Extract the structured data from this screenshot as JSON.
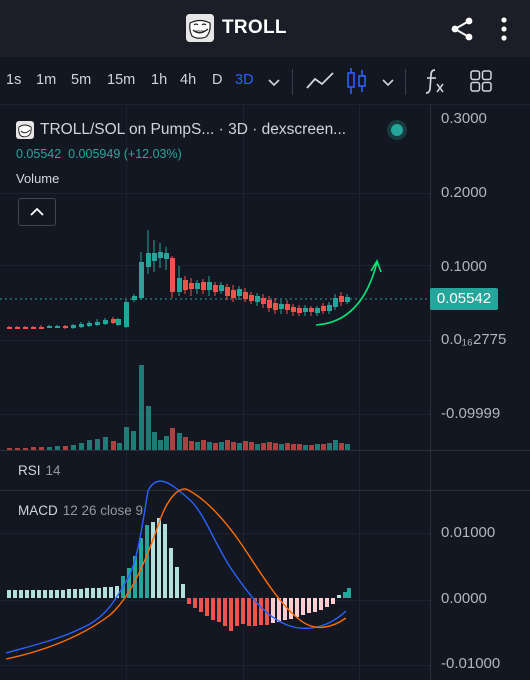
{
  "header": {
    "title": "TROLL",
    "icons": {
      "logo": "troll-face-logo",
      "share": "share-icon",
      "more": "more-vertical-icon"
    }
  },
  "toolbar": {
    "timeframes": [
      "1s",
      "1m",
      "5m",
      "15m",
      "1h",
      "4h",
      "D",
      "3D"
    ],
    "active_timeframe": "3D",
    "icons": [
      "chevron-down-icon",
      "line-chart-icon",
      "candles-icon",
      "chevron-down-icon",
      "indicators-fx-icon",
      "layout-grid-icon"
    ],
    "accent_color": "#2962ff"
  },
  "legend": {
    "title": "TROLL/SOL on PumpS... · 3D · dexscreen...",
    "ohlc_values": "0.05542  0.005949 (+12.03%)",
    "volume_label": "Volume"
  },
  "price_scale": {
    "labels": [
      "0.3000",
      "0.2000",
      "0.1000",
      "0.05542",
      "0.0₁₆2775",
      "-0.09999"
    ],
    "current_price": "0.05542"
  },
  "indicators": {
    "rsi": {
      "name": "RSI",
      "params": "14"
    },
    "macd": {
      "name": "MACD",
      "params": "12 26 close 9",
      "scale_labels": [
        "0.01000",
        "0.0000",
        "-0.01000"
      ]
    }
  },
  "colors": {
    "background": "#131722",
    "up": "#26a69a",
    "down": "#ef5350",
    "macd_line": "#2962ff",
    "signal_line": "#ff6d00",
    "arrow": "#00e676"
  }
}
